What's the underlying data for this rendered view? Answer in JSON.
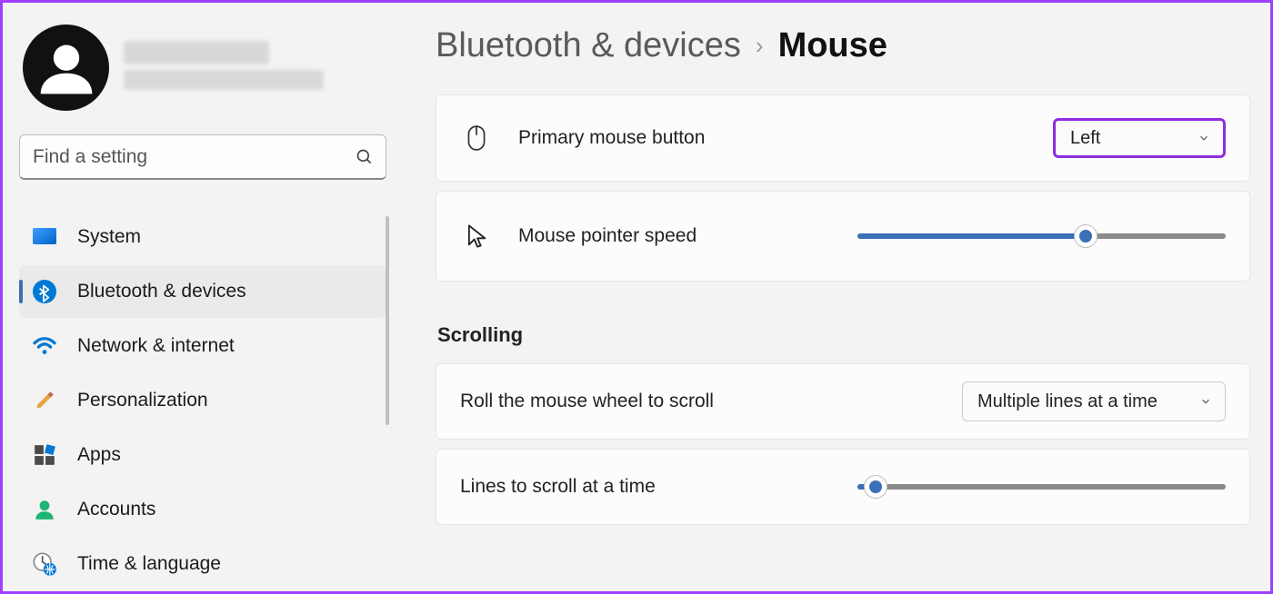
{
  "sidebar": {
    "search_placeholder": "Find a setting",
    "items": [
      {
        "label": "System",
        "icon": "monitor-icon"
      },
      {
        "label": "Bluetooth & devices",
        "icon": "bluetooth-icon"
      },
      {
        "label": "Network & internet",
        "icon": "wifi-icon"
      },
      {
        "label": "Personalization",
        "icon": "paintbrush-icon"
      },
      {
        "label": "Apps",
        "icon": "apps-icon"
      },
      {
        "label": "Accounts",
        "icon": "person-icon"
      },
      {
        "label": "Time & language",
        "icon": "clock-globe-icon"
      }
    ],
    "active_index": 1
  },
  "breadcrumb": {
    "parent": "Bluetooth & devices",
    "current": "Mouse"
  },
  "settings": {
    "primary_button": {
      "label": "Primary mouse button",
      "value": "Left"
    },
    "pointer_speed": {
      "label": "Mouse pointer speed",
      "percent": 62
    },
    "scrolling_header": "Scrolling",
    "wheel_scroll": {
      "label": "Roll the mouse wheel to scroll",
      "value": "Multiple lines at a time"
    },
    "lines_scroll": {
      "label": "Lines to scroll at a time",
      "percent": 5
    }
  }
}
